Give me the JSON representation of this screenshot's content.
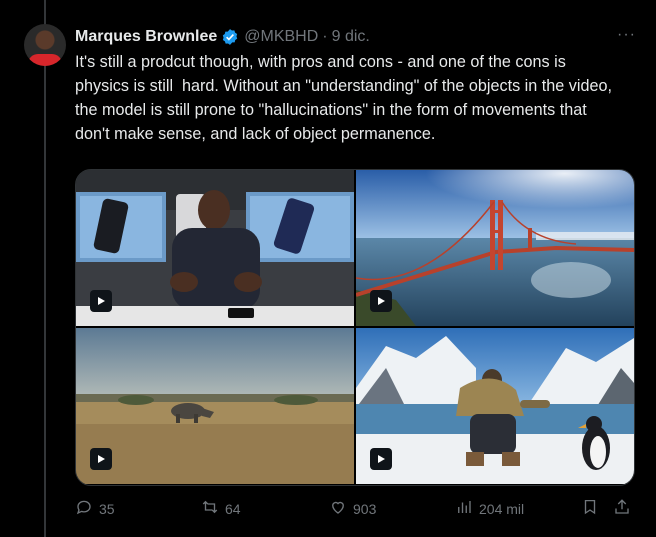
{
  "author": {
    "name": "Marques Brownlee",
    "handle": "@MKBHD",
    "separator": "·",
    "date": "9 dic.",
    "more": "···"
  },
  "tweet": {
    "text": "It's still a prodcut though, with pros and cons - and one of the cons is\nphysics is still  hard. Without an \"understanding\" of the objects in the video,\nthe model is still prone to \"hallucinations\" in the form of movements that\ndon't make sense, and lack of object permanence."
  },
  "media": [
    {
      "kind": "video",
      "subject": "man-with-phones"
    },
    {
      "kind": "video",
      "subject": "golden-gate-bridge"
    },
    {
      "kind": "video",
      "subject": "rhino-savanna"
    },
    {
      "kind": "video",
      "subject": "man-with-penguin"
    }
  ],
  "actions": {
    "replies": "35",
    "reposts": "64",
    "likes": "903",
    "views": "204 mil"
  },
  "colors": {
    "background": "#000000",
    "text": "#e7e9ea",
    "muted": "#71767b",
    "verified": "#1d9bf0",
    "divider": "#2f3336"
  }
}
